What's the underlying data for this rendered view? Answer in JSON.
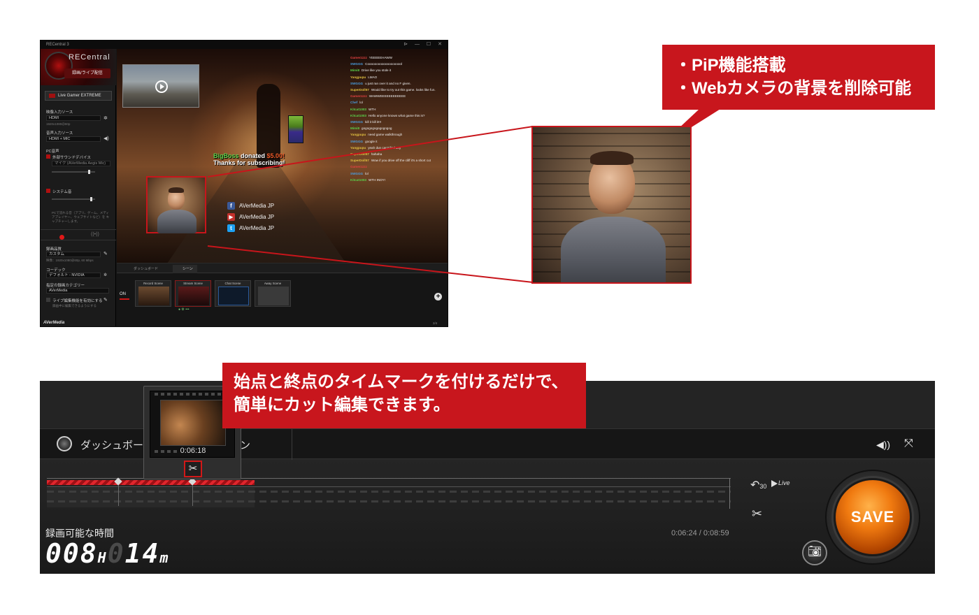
{
  "top_window": {
    "title": "RECentral 3",
    "window_controls": "⊳ — ☐ ✕",
    "logo_text": "RECentral",
    "record_tab_label": "録画/ライブ配信",
    "device_label": "Live Gamer EXTREME",
    "video_source_label": "映像入力ソース",
    "video_source_value": "HDMI",
    "video_source_detail": "1920x1080@60p",
    "audio_source_label": "音声入力ソース",
    "audio_source_value": "HDMI + MIC",
    "pc_audio_label": "PC音声",
    "external_device_label": "外部サウンドデバイス",
    "mic_value": "マイク (AVerMedia Aegis Mic)",
    "system_sound_label": "システム音",
    "pc_audio_note": "PCで流れる音（アプリ、ゲーム、メディアプレイヤー、ウェブサイトなど）を キャプチャーします。",
    "quality_label": "録画品質",
    "quality_value": "カスタム",
    "quality_detail": "映像：1920x1080@60p, 60 Mbps",
    "codec_label": "コーデック",
    "codec_value": "デフォルト - NVIDIA",
    "folder_label": "指定の録画カテゴリー",
    "folder_value": "AVerMedia",
    "live_edit_label": "ライブ編集機能を有効にする",
    "live_edit_note": "録画中に編集できるようにする",
    "avermedia_logo": "AVerMedia"
  },
  "stream_overlay": {
    "donation_name": "BigBoss",
    "donation_text": "donated",
    "donation_amount": "$5.00!",
    "donation_thanks": "Thanks for subscribing!",
    "chat": [
      {
        "user": "Gamerzzzz",
        "color": "#e04040",
        "msg": "YEEEEEHAWW"
      },
      {
        "user": "SWGGG",
        "color": "#4a9ee0",
        "msg": "Coooooooooooooooooool"
      },
      {
        "user": "Mimi8",
        "color": "#59d14a",
        "msg": "Drive like you stole it"
      },
      {
        "user": "Yangpupu",
        "color": "#e0c040",
        "msg": "LMAO"
      },
      {
        "user": "SWGGG",
        "color": "#4a9ee0",
        "msg": "u just ran over it and no F given."
      },
      {
        "user": "SuperDoll57",
        "color": "#e0c040",
        "msg": "Would like to try out this game. looks like fun."
      },
      {
        "user": "Gamerzzzz",
        "color": "#e04040",
        "msg": "WAWWEEEEEEEEEEEE"
      },
      {
        "user": "Chef",
        "color": "#4a9ee0",
        "msg": "lol"
      },
      {
        "user": "Kitcat1003",
        "color": "#59d14a",
        "msg": "WTH"
      },
      {
        "user": "Kitcat1003",
        "color": "#59d14a",
        "msg": "Hello anyone knows what game this is?"
      },
      {
        "user": "SWGGG",
        "color": "#4a9ee0",
        "msg": "kill it kill it!!!"
      },
      {
        "user": "Mimi8",
        "color": "#59d14a",
        "msg": "gogogogogogogogog"
      },
      {
        "user": "Yangpupu",
        "color": "#e0c040",
        "msg": "need game walkthrough"
      },
      {
        "user": "SWGGG",
        "color": "#4a9ee0",
        "msg": "google it"
      },
      {
        "user": "Yangpupu",
        "color": "#e0c040",
        "msg": "yeah dun can't find any"
      },
      {
        "user": "SuperDoll57",
        "color": "#e0c040",
        "msg": "hahaha"
      },
      {
        "user": "SuperDoll57",
        "color": "#e0c040",
        "msg": "Wow if you drive off the cliff it's a short cut"
      },
      {
        "user": "Gamerzzzz",
        "color": "#e04040",
        "msg": ""
      },
      {
        "user": "SWGGG",
        "color": "#4a9ee0",
        "msg": "lol"
      },
      {
        "user": "Kitcat1003",
        "color": "#59d14a",
        "msg": "WTH INDY!"
      }
    ],
    "social": [
      {
        "icon": "f",
        "color": "#3b5998",
        "label": "AVerMedia JP"
      },
      {
        "icon": "▶",
        "color": "#c4302b",
        "label": "AVerMedia JP"
      },
      {
        "icon": "t",
        "color": "#1da1f2",
        "label": "AVerMedia JP"
      }
    ]
  },
  "scene_panel": {
    "tab_dashboard": "ダッシュボード",
    "tab_scene": "シーン",
    "on_label": "ON",
    "scenes": [
      {
        "label": "Record Scene"
      },
      {
        "label": "Stream Scene"
      },
      {
        "label": "Chat Scene"
      },
      {
        "label": "Away Scene"
      }
    ],
    "page_count": "2/4"
  },
  "callout_top": {
    "line1": "・PiP機能搭載",
    "line2": "・Webカメラの背景を削除可能"
  },
  "editor": {
    "dashboard_label": "ダッシュボード",
    "hidden_tab_label": "ン",
    "thumb_time": "0:06:18",
    "time_readout": "0:06:24 / 0:08:59",
    "rec_time_label": "録画可能な時間",
    "rec_hours": "008",
    "rec_h_unit": "H",
    "rec_minutes_dim": "0",
    "rec_minutes": "14",
    "rec_m_unit": "m",
    "save_label": "SAVE",
    "rewind_label": "30",
    "live_label": "Live",
    "played_fraction": 0.304
  },
  "callout_bottom": {
    "line1": "始点と終点のタイムマークを付けるだけで、",
    "line2": "簡単にカット編集できます。"
  },
  "colors": {
    "accent_red": "#c8161d",
    "save_orange": "#f07a10"
  }
}
